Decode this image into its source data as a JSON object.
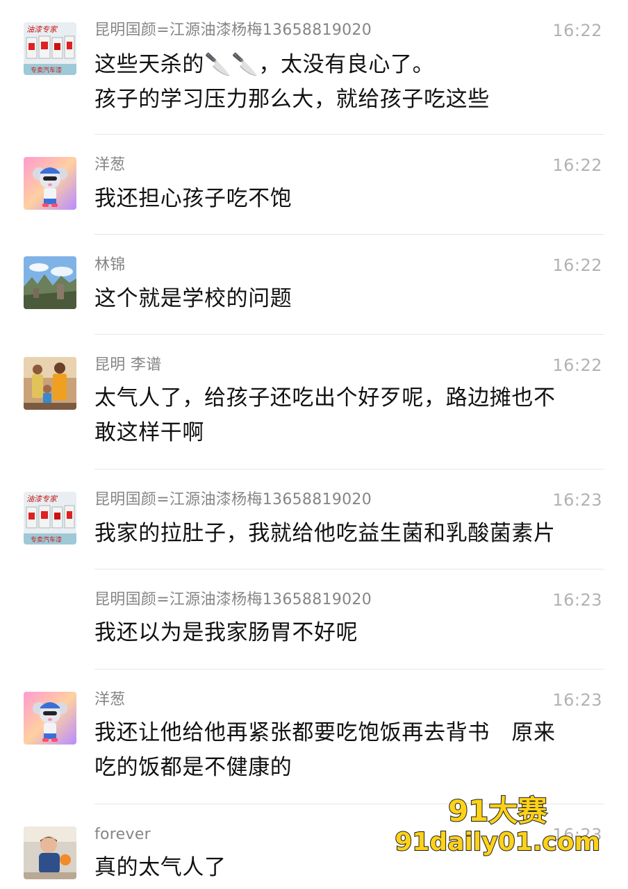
{
  "messages": [
    {
      "sender": "昆明国颜=江源油漆杨梅13658819020",
      "time": "16:22",
      "avatar": "paint-shop-avatar",
      "lines": [
        "这些天杀的🔪🔪，太没有良心了。",
        "孩子的学习压力那么大，就给孩子吃这些"
      ]
    },
    {
      "sender": "洋葱",
      "time": "16:22",
      "avatar": "cartoon-mouse-avatar",
      "lines": [
        "我还担心孩子吃不饱"
      ]
    },
    {
      "sender": "林锦",
      "time": "16:22",
      "avatar": "landscape-avatar",
      "lines": [
        "这个就是学校的问题"
      ]
    },
    {
      "sender": "昆明 李谱",
      "time": "16:22",
      "avatar": "family-photo-avatar",
      "lines": [
        "太气人了，给孩子还吃出个好歹呢，路边摊也不",
        "敢这样干啊"
      ]
    },
    {
      "sender": "昆明国颜=江源油漆杨梅13658819020",
      "time": "16:23",
      "avatar": "paint-shop-avatar",
      "lines": [
        "我家的拉肚子，我就给他吃益生菌和乳酸菌素片"
      ]
    },
    {
      "sender": "昆明国颜=江源油漆杨梅13658819020",
      "time": "16:23",
      "avatar": "",
      "lines": [
        "我还以为是我家肠胃不好呢"
      ]
    },
    {
      "sender": "洋葱",
      "time": "16:23",
      "avatar": "cartoon-mouse-avatar",
      "lines": [
        "我还让他给他再紧张都要吃饱饭再去背书　原来",
        "吃的饭都是不健康的"
      ]
    },
    {
      "sender": "forever",
      "time": "16:23",
      "avatar": "child-photo-avatar",
      "lines": [
        "真的太气人了"
      ]
    }
  ],
  "paint_avatar": {
    "top_text": "油漆专家",
    "bottom_text": "专卖汽车漆"
  },
  "watermark": {
    "line1": "91大赛",
    "line2": "91daily01.com"
  },
  "colors": {
    "sender": "#858585",
    "time": "#b2b2b2",
    "text": "#111111",
    "divider": "#e6e6e6",
    "watermark_fill": "#ffd21a"
  }
}
